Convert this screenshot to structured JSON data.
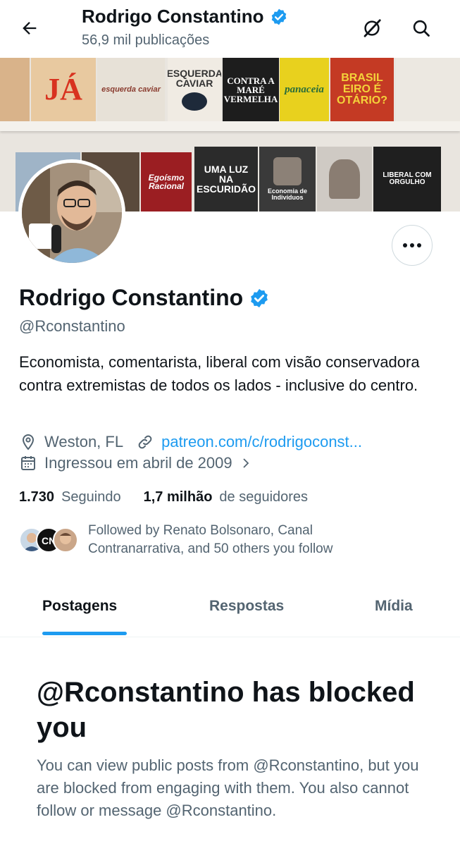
{
  "header": {
    "title": "Rodrigo Constantino",
    "subtitle": "56,9 mil publicações"
  },
  "banner": {
    "books": [
      {
        "text": "JÁ",
        "color": "#e8c9a0",
        "fg": "#d8321f"
      },
      {
        "text": "ESQUERDA CAVIAR",
        "color": "#f0ebe3",
        "fg": "#333333"
      },
      {
        "text": "CONTRA A MARÉ VERMELHA",
        "color": "#1d1d1d",
        "fg": "#ffffff"
      },
      {
        "text": "panaceia",
        "color": "#e8d11e",
        "fg": "#2a6d3a"
      },
      {
        "text": "BRASIL EIRO É OTÁRIO?",
        "color": "#c43a24",
        "fg": "#f4d23a"
      },
      {
        "text": "Egoísmo Racional",
        "color": "#9b1e22",
        "fg": "#ffffff"
      },
      {
        "text": "UMA LUZ NA ESCURIDÃO",
        "color": "#2b2b2b",
        "fg": "#ffffff"
      },
      {
        "text": "Economia de Indivíduos",
        "color": "#3a3a3a",
        "fg": "#ffffff"
      },
      {
        "text": "LIBERAL COM ORGULHO",
        "color": "#1f1f1f",
        "fg": "#ffffff"
      }
    ]
  },
  "profile": {
    "name": "Rodrigo Constantino",
    "handle": "@Rconstantino",
    "bio": "Economista, comentarista, liberal com visão conservadora contra extremistas de todos os lados - inclusive do centro.",
    "location": "Weston, FL",
    "website": "patreon.com/c/rodrigoconst...",
    "joined": "Ingressou em abril de 2009",
    "following_count": "1.730",
    "following_label": "Seguindo",
    "followers_count": "1,7 milhão",
    "followers_label": "de seguidores",
    "followed_by": "Followed by Renato Bolsonaro, Canal Contranarrativa, and 50 others you follow"
  },
  "tabs": [
    {
      "label": "Postagens",
      "active": true
    },
    {
      "label": "Respostas",
      "active": false
    },
    {
      "label": "Mídia",
      "active": false
    }
  ],
  "blocked": {
    "title": "@Rconstantino has blocked you",
    "description": "You can view public posts from @Rconstantino, but you are blocked from engaging with them. You also cannot follow or message @Rconstantino."
  },
  "colors": {
    "accent": "#1d9bf0",
    "verified": "#1d9bf0",
    "text_secondary": "#536471"
  }
}
